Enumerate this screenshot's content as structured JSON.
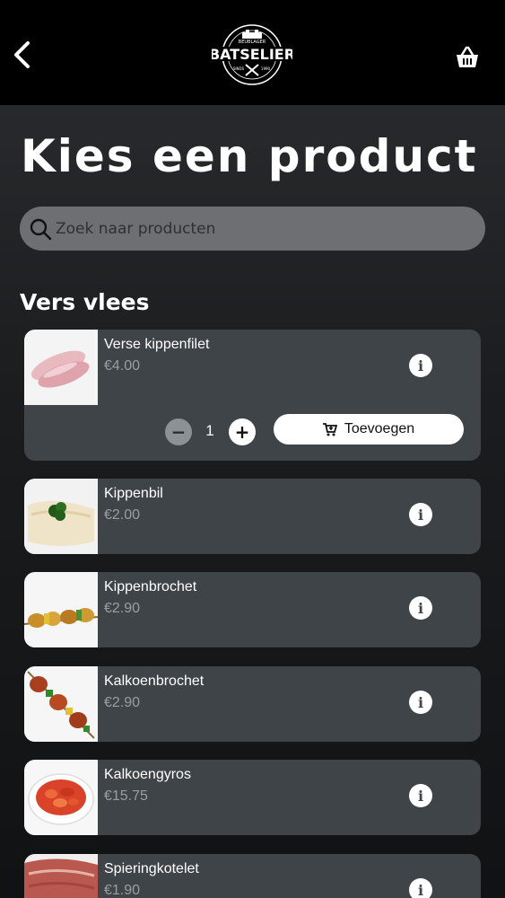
{
  "header": {
    "back_icon": "chevron-left-icon",
    "logo_text": "BATSELIER",
    "logo_top": "BEENHOUWERIJ • SLAGERIJ • TRAITEUR",
    "logo_sub": "BEUBLAGER",
    "logo_since": "SINDS 1990",
    "logo_bottom": "VAN DE SLAGERIJ",
    "cart_icon": "basket-icon"
  },
  "page": {
    "title": "Kies een product"
  },
  "search": {
    "placeholder": "Zoek naar producten",
    "icon": "search-icon"
  },
  "section": {
    "title": "Vers vlees"
  },
  "products": [
    {
      "name": "Verse kippenfilet",
      "price": "€4.00",
      "quantity": "1",
      "add_label": "Toevoegen"
    },
    {
      "name": "Kippenbil",
      "price": "€2.00"
    },
    {
      "name": "Kippenbrochet",
      "price": "€2.90"
    },
    {
      "name": "Kalkoenbrochet",
      "price": "€2.90"
    },
    {
      "name": "Kalkoengyros",
      "price": "€15.75"
    },
    {
      "name": "Spieringkotelet",
      "price": "€1.90"
    }
  ],
  "colors": {
    "topbar": "#000000",
    "card": "#3f4449",
    "search": "#6e6f72",
    "price": "#9a9ea3"
  }
}
